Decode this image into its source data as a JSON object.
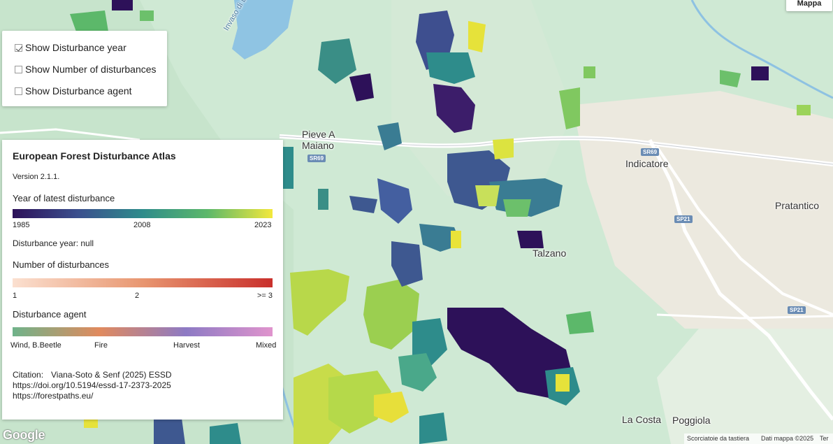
{
  "layer_control": {
    "items": [
      {
        "label": "Show Disturbance year",
        "checked": true
      },
      {
        "label": "Show Number of disturbances",
        "checked": false
      },
      {
        "label": "Show Disturbance agent",
        "checked": false
      }
    ]
  },
  "legend": {
    "title": "European Forest Disturbance Atlas",
    "version": "Version 2.1.1.",
    "year": {
      "heading": "Year of latest disturbance",
      "ticks": [
        "1985",
        "2008",
        "2023"
      ],
      "colors": [
        "#2d1159",
        "#3b4f8e",
        "#2e8c8b",
        "#5cb86a",
        "#f3e83c"
      ],
      "readout": "Disturbance year: null"
    },
    "count": {
      "heading": "Number of disturbances",
      "ticks": [
        "1",
        "2",
        ">= 3"
      ],
      "colors": [
        "#fbe0d0",
        "#e89670",
        "#c9302c"
      ]
    },
    "agent": {
      "heading": "Disturbance agent",
      "ticks": [
        "Wind, B.Beetle",
        "Fire",
        "Harvest",
        "Mixed"
      ],
      "colors": [
        "#6fb38a",
        "#e08a5e",
        "#8d7ac4",
        "#e094cd"
      ]
    },
    "citation": {
      "label": "Citation:",
      "text": "Viana-Soto & Senf (2025) ESSD",
      "doi": "https://doi.org/10.5194/essd-17-2373-2025",
      "site": "https://forestpaths.eu/"
    }
  },
  "map": {
    "type_button": "Mappa",
    "places": [
      "Pieve A",
      "Maiano",
      "Indicatore",
      "Pratantico",
      "Talzano",
      "La Costa",
      "Poggiola"
    ],
    "lake_label": "Invaso di La Penna",
    "roads": [
      "SR69",
      "SR69",
      "SP21",
      "SP21"
    ],
    "attribution": {
      "shortcuts": "Scorciatoie da tastiera",
      "data": "Dati mappa ©2025",
      "terms": "Ter"
    },
    "logo": "Google"
  }
}
